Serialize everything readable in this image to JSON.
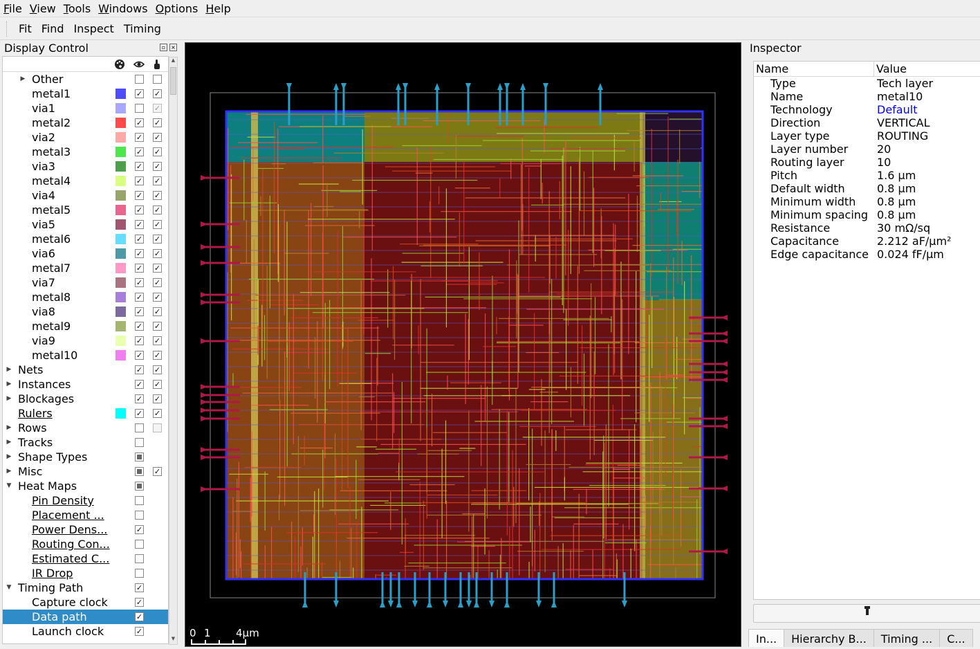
{
  "menubar": [
    {
      "pre": "",
      "u": "F",
      "post": "ile"
    },
    {
      "pre": "",
      "u": "V",
      "post": "iew"
    },
    {
      "pre": "",
      "u": "T",
      "post": "ools"
    },
    {
      "pre": "",
      "u": "W",
      "post": "indows"
    },
    {
      "pre": "",
      "u": "O",
      "post": "ptions"
    },
    {
      "pre": "",
      "u": "H",
      "post": "elp"
    }
  ],
  "toolbar": [
    "Fit",
    "Find",
    "Inspect",
    "Timing"
  ],
  "display_control": {
    "title": "Display Control",
    "header_icons": [
      "palette-icon",
      "eye-icon",
      "pointer-hand-icon"
    ],
    "rows": [
      {
        "label": "Other",
        "indent": 1,
        "arrow": "right",
        "c1": "empty",
        "c2": "empty"
      },
      {
        "label": "metal1",
        "indent": 2,
        "color": "#4d4dff",
        "c1": "check",
        "c2": "check"
      },
      {
        "label": "via1",
        "indent": 2,
        "color": "#a8a8ff",
        "c1": "empty",
        "c2": "dimcheck"
      },
      {
        "label": "metal2",
        "indent": 2,
        "color": "#ff4a4a",
        "c1": "check",
        "c2": "check"
      },
      {
        "label": "via2",
        "indent": 2,
        "color": "#ffa8a8",
        "c1": "check",
        "c2": "check"
      },
      {
        "label": "metal3",
        "indent": 2,
        "color": "#4de64d",
        "c1": "check",
        "c2": "check"
      },
      {
        "label": "via3",
        "indent": 2,
        "color": "#4ca04c",
        "c1": "check",
        "c2": "check"
      },
      {
        "label": "metal4",
        "indent": 2,
        "color": "#d8ff7f",
        "c1": "check",
        "c2": "check"
      },
      {
        "label": "via4",
        "indent": 2,
        "color": "#97a56a",
        "c1": "check",
        "c2": "check"
      },
      {
        "label": "metal5",
        "indent": 2,
        "color": "#e8668c",
        "c1": "check",
        "c2": "check"
      },
      {
        "label": "via5",
        "indent": 2,
        "color": "#a0576e",
        "c1": "check",
        "c2": "check"
      },
      {
        "label": "metal6",
        "indent": 2,
        "color": "#66dcff",
        "c1": "check",
        "c2": "check"
      },
      {
        "label": "via6",
        "indent": 2,
        "color": "#4c9aa5",
        "c1": "check",
        "c2": "check"
      },
      {
        "label": "metal7",
        "indent": 2,
        "color": "#ff9ac6",
        "c1": "check",
        "c2": "check"
      },
      {
        "label": "via7",
        "indent": 2,
        "color": "#a9737f",
        "c1": "check",
        "c2": "check"
      },
      {
        "label": "metal8",
        "indent": 2,
        "color": "#a67fdb",
        "c1": "check",
        "c2": "check"
      },
      {
        "label": "via8",
        "indent": 2,
        "color": "#7a6a9e",
        "c1": "check",
        "c2": "check"
      },
      {
        "label": "metal9",
        "indent": 2,
        "color": "#a6b56e",
        "c1": "check",
        "c2": "check"
      },
      {
        "label": "via9",
        "indent": 2,
        "color": "#ebffb0",
        "c1": "check",
        "c2": "check"
      },
      {
        "label": "metal10",
        "indent": 2,
        "color": "#f07ff0",
        "c1": "check",
        "c2": "check"
      },
      {
        "label": "Nets",
        "indent": 0,
        "arrow": "right",
        "c1": "check",
        "c2": "check"
      },
      {
        "label": "Instances",
        "indent": 0,
        "arrow": "right",
        "c1": "check",
        "c2": "check"
      },
      {
        "label": "Blockages",
        "indent": 0,
        "arrow": "right",
        "c1": "check",
        "c2": "check"
      },
      {
        "label": "Rulers",
        "indent": 0,
        "underline": true,
        "color": "#00ffff",
        "c1": "check",
        "c2": "check"
      },
      {
        "label": "Rows",
        "indent": 0,
        "arrow": "right",
        "c1": "empty",
        "c2": "dim"
      },
      {
        "label": "Tracks",
        "indent": 0,
        "arrow": "right",
        "c1": "empty"
      },
      {
        "label": "Shape Types",
        "indent": 0,
        "arrow": "right",
        "c1": "partial"
      },
      {
        "label": "Misc",
        "indent": 0,
        "arrow": "right",
        "c1": "partial",
        "c2": "check"
      },
      {
        "label": "Heat Maps",
        "indent": 0,
        "arrow": "down",
        "c1": "partial"
      },
      {
        "label": "Pin Density",
        "indent": 2,
        "underline": true,
        "c1": "empty"
      },
      {
        "label": "Placement ...",
        "indent": 2,
        "underline": true,
        "c1": "empty"
      },
      {
        "label": "Power Dens...",
        "indent": 2,
        "underline": true,
        "c1": "check"
      },
      {
        "label": "Routing Con...",
        "indent": 2,
        "underline": true,
        "c1": "empty"
      },
      {
        "label": "Estimated C...",
        "indent": 2,
        "underline": true,
        "c1": "empty"
      },
      {
        "label": "IR Drop",
        "indent": 2,
        "underline": true,
        "c1": "empty"
      },
      {
        "label": "Timing Path",
        "indent": 0,
        "arrow": "down",
        "c1": "check"
      },
      {
        "label": "Capture clock",
        "indent": 2,
        "c1": "check"
      },
      {
        "label": "Data path",
        "indent": 2,
        "c1": "check",
        "selected": true
      },
      {
        "label": "Launch clock",
        "indent": 2,
        "c1": "check"
      }
    ]
  },
  "scale_bar": {
    "ticks": [
      "0",
      "1",
      "4μm"
    ]
  },
  "inspector": {
    "title": "Inspector",
    "col_name": "Name",
    "col_value": "Value",
    "rows": [
      {
        "name": "Type",
        "value": "Tech layer"
      },
      {
        "name": "Name",
        "value": "metal10"
      },
      {
        "name": "Technology",
        "value": "Default",
        "link": true
      },
      {
        "name": "Direction",
        "value": "VERTICAL"
      },
      {
        "name": "Layer type",
        "value": "ROUTING"
      },
      {
        "name": "Layer number",
        "value": "20"
      },
      {
        "name": "Routing layer",
        "value": "10"
      },
      {
        "name": "Pitch",
        "value": "1.6 μm"
      },
      {
        "name": "Default width",
        "value": "0.8 μm"
      },
      {
        "name": "Minimum width",
        "value": "0.8 μm"
      },
      {
        "name": "Minimum spacing",
        "value": "0.8 μm"
      },
      {
        "name": "Resistance",
        "value": "30 mΩ/sq"
      },
      {
        "name": "Capacitance",
        "value": "2.212 aF/μm²"
      },
      {
        "name": "Edge capacitance",
        "value": "0.024 fF/μm"
      }
    ],
    "button_icon": "flashlight-icon",
    "tabs": [
      "In...",
      "Hierarchy B...",
      "Timing ...",
      "C..."
    ]
  }
}
